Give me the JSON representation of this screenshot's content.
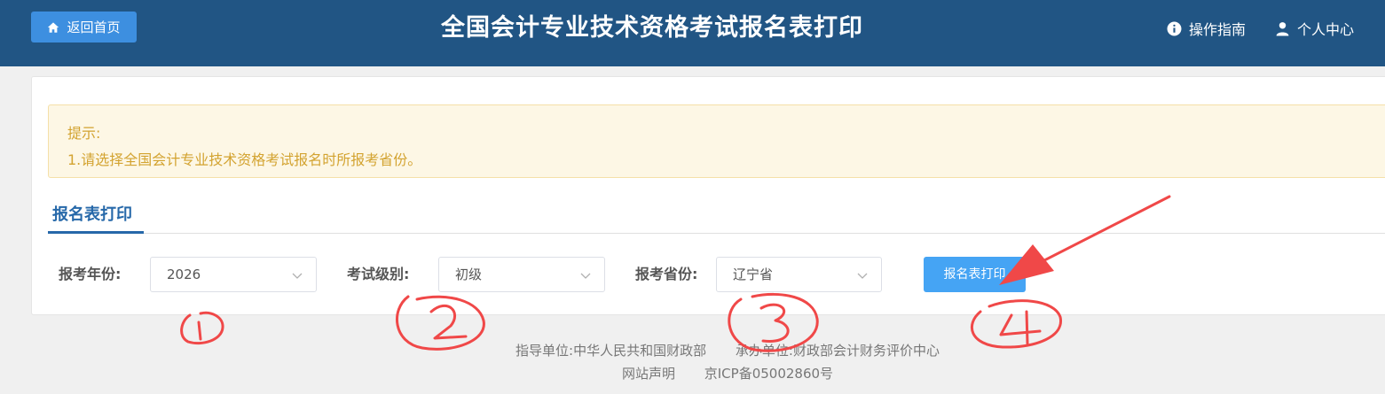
{
  "header": {
    "home_label": "返回首页",
    "title": "全国会计专业技术资格考试报名表打印",
    "guide_label": "操作指南",
    "personal_label": "个人中心"
  },
  "tip": {
    "title": "提示:",
    "line1": "1.请选择全国会计专业技术资格考试报名时所报考省份。"
  },
  "tab": {
    "label": "报名表打印"
  },
  "form": {
    "year_label": "报考年份:",
    "year_value": "2026",
    "level_label": "考试级别:",
    "level_value": "初级",
    "province_label": "报考省份:",
    "province_value": "辽宁省",
    "print_label": "报名表打印"
  },
  "footer": {
    "guide_unit": "指导单位:中华人民共和国财政部",
    "host_unit": "承办单位:财政部会计财务评价中心",
    "statement": "网站声明",
    "icp": "京ICP备05002860号"
  },
  "colors": {
    "header_bg": "#215584",
    "accent": "#3d8fe0",
    "annotation": "#f04848"
  }
}
